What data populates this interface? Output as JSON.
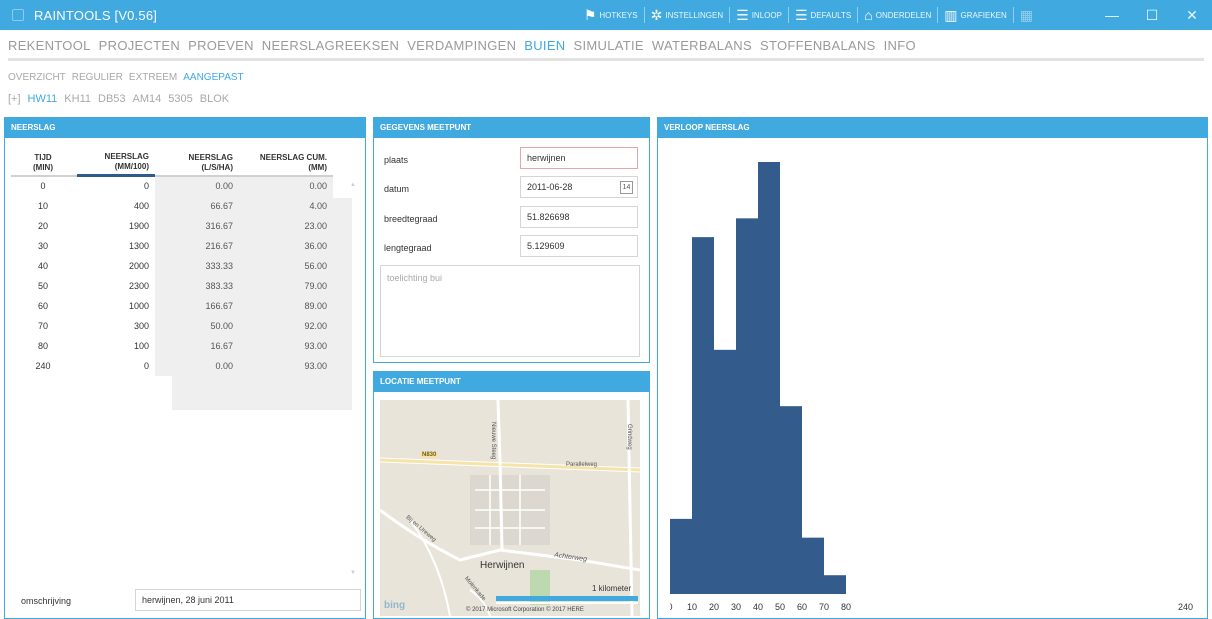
{
  "window": {
    "title": "RAINTOOLS [V0.56]",
    "actions": [
      {
        "icon": "hotkeys-icon",
        "glyph": "⚑",
        "label": "HOTKEYS",
        "disabled": false
      },
      {
        "icon": "gear-icon",
        "glyph": "✲",
        "label": "INSTELLINGEN",
        "disabled": false
      },
      {
        "icon": "import-icon",
        "glyph": "☰",
        "label": "INLOOP",
        "disabled": false
      },
      {
        "icon": "defaults-icon",
        "glyph": "☰",
        "label": "DEFAULTS",
        "disabled": false
      },
      {
        "icon": "home-icon",
        "glyph": "⌂",
        "label": "ONDERDELEN",
        "disabled": false
      },
      {
        "icon": "chart-icon",
        "glyph": "▥",
        "label": "GRAFIEKEN",
        "disabled": false
      },
      {
        "icon": "report-icon",
        "glyph": "▦",
        "label": "",
        "disabled": true
      }
    ],
    "controls": {
      "minimize": "—",
      "maximize": "☐",
      "close": "✕"
    }
  },
  "nav": {
    "main": [
      "REKENTOOL",
      "PROJECTEN",
      "PROEVEN",
      "NEERSLAGREEKSEN",
      "VERDAMPINGEN",
      "BUIEN",
      "SIMULATIE",
      "WATERBALANS",
      "STOFFENBALANS",
      "INFO"
    ],
    "main_active": "BUIEN",
    "sub": [
      "OVERZICHT",
      "REGULIER",
      "EXTREEM",
      "AANGEPAST"
    ],
    "sub_active": "AANGEPAST",
    "third": [
      "[+]",
      "HW11",
      "KH11",
      "DB53",
      "AM14",
      "5305",
      "BLOK"
    ],
    "third_active": "HW11"
  },
  "neerslag": {
    "title": "NEERSLAG",
    "columns": [
      {
        "line1": "TIJD",
        "line2": "(MIN)"
      },
      {
        "line1": "NEERSLAG",
        "line2": "(MM/100)"
      },
      {
        "line1": "NEERSLAG",
        "line2": "(L/S/HA)"
      },
      {
        "line1": "NEERSLAG CUM.",
        "line2": "(MM)"
      }
    ],
    "rows": [
      [
        "0",
        "0",
        "0.00",
        "0.00"
      ],
      [
        "10",
        "400",
        "66.67",
        "4.00"
      ],
      [
        "20",
        "1900",
        "316.67",
        "23.00"
      ],
      [
        "30",
        "1300",
        "216.67",
        "36.00"
      ],
      [
        "40",
        "2000",
        "333.33",
        "56.00"
      ],
      [
        "50",
        "2300",
        "383.33",
        "79.00"
      ],
      [
        "60",
        "1000",
        "166.67",
        "89.00"
      ],
      [
        "70",
        "300",
        "50.00",
        "92.00"
      ],
      [
        "80",
        "100",
        "16.67",
        "93.00"
      ],
      [
        "240",
        "0",
        "0.00",
        "93.00"
      ]
    ],
    "omschrijving_label": "omschrijving",
    "omschrijving_value": "herwijnen, 28 juni 2011"
  },
  "meetpunt": {
    "title": "GEGEVENS MEETPUNT",
    "plaats_label": "plaats",
    "plaats_value": "herwijnen",
    "datum_label": "datum",
    "datum_value": "2011-06-28",
    "calendar_day": "14",
    "breedte_label": "breedtegraad",
    "breedte_value": "51.826698",
    "lengte_label": "lengtegraad",
    "lengte_value": "5.129609",
    "toelichting_placeholder": "toelichting bui"
  },
  "locatie": {
    "title": "LOCATIE MEETPUNT",
    "labels": {
      "road": "N830",
      "street1": "Nieuwe Steeg",
      "street2": "Parallelweg",
      "street3": "Achterweg",
      "street4": "Bij en Ureweg",
      "street5": "Molenkade",
      "street6": "Grindweg",
      "town": "Herwijnen",
      "scale": "1 kilometer",
      "brand": "bing",
      "copyright": "© 2017 Microsoft Corporation  © 2017 HERE"
    }
  },
  "verloop": {
    "title": "VERLOOP NEERSLAG",
    "bar_color": "#335c8d"
  },
  "chart_data": {
    "type": "bar",
    "categories": [
      "0",
      "10",
      "20",
      "30",
      "40",
      "50",
      "60",
      "70",
      "80"
    ],
    "values": [
      400,
      1900,
      1300,
      2000,
      2300,
      1000,
      300,
      100,
      0
    ],
    "x": [
      0,
      10,
      20,
      30,
      40,
      50,
      60,
      70,
      80
    ],
    "xticks": [
      "0",
      "10",
      "20",
      "30",
      "40",
      "50",
      "60",
      "70",
      "80",
      "240"
    ],
    "xlim": [
      0,
      240
    ],
    "ylim": [
      0,
      2300
    ],
    "title": "",
    "xlabel": "",
    "ylabel": "",
    "grid": false
  }
}
